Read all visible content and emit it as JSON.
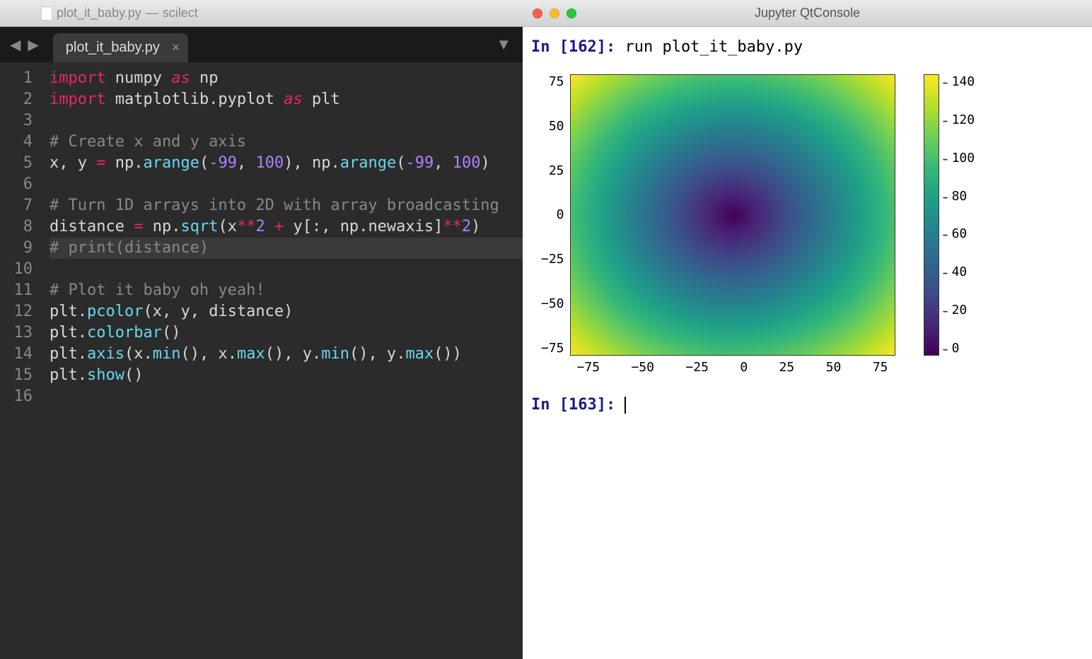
{
  "editor": {
    "window_title_file": "plot_it_baby.py",
    "window_title_project": "scilect",
    "tab_name": "plot_it_baby.py",
    "lines": [
      "1",
      "2",
      "3",
      "4",
      "5",
      "6",
      "7",
      "8",
      "9",
      "10",
      "11",
      "12",
      "13",
      "14",
      "15",
      "16"
    ],
    "code": {
      "l1_import": "import",
      "l1_mod": "numpy",
      "l1_as": "as",
      "l1_alias": "np",
      "l2_import": "import",
      "l2_mod": "matplotlib.pyplot",
      "l2_as": "as",
      "l2_alias": "plt",
      "l4": "# Create x and y axis",
      "l5_a": "x",
      "l5_comma1": ",",
      "l5_b": "y",
      "l5_eq": "=",
      "l5_np1": "np",
      "l5_dot1": ".",
      "l5_f1": "arange",
      "l5_p1": "(",
      "l5_n1": "-99",
      "l5_c1": ",",
      "l5_n2": "100",
      "l5_p2": "),",
      "l5_np2": "np",
      "l5_dot2": ".",
      "l5_f2": "arange",
      "l5_p3": "(",
      "l5_n3": "-99",
      "l5_c2": ",",
      "l5_n4": "100",
      "l5_p4": ")",
      "l7": "# Turn 1D arrays into 2D with array broadcasting",
      "l8_a": "distance",
      "l8_eq": "=",
      "l8_np": "np",
      "l8_d": ".",
      "l8_f": "sqrt",
      "l8_p1": "(x",
      "l8_pow1": "**",
      "l8_n1": "2",
      "l8_plus": "+",
      "l8_y": "y[:,",
      "l8_np2": "np",
      "l8_d2": ".",
      "l8_na": "newaxis]",
      "l8_pow2": "**",
      "l8_n2": "2",
      "l8_p2": ")",
      "l9": "# print(distance)",
      "l11": "# Plot it baby oh yeah!",
      "l12_a": "plt",
      "l12_d": ".",
      "l12_f": "pcolor",
      "l12_args": "(x, y, distance)",
      "l13_a": "plt",
      "l13_d": ".",
      "l13_f": "colorbar",
      "l13_args": "()",
      "l14_a": "plt",
      "l14_d": ".",
      "l14_f": "axis",
      "l14_p1": "(x",
      "l14_d1": ".",
      "l14_f1": "min",
      "l14_c1": "(), x",
      "l14_d2": ".",
      "l14_f2": "max",
      "l14_c2": "(), y",
      "l14_d3": ".",
      "l14_f3": "min",
      "l14_c3": "(), y",
      "l14_d4": ".",
      "l14_f4": "max",
      "l14_c4": "())",
      "l15_a": "plt",
      "l15_d": ".",
      "l15_f": "show",
      "l15_args": "()"
    }
  },
  "console": {
    "window_title": "Jupyter QtConsole",
    "prompt1": "In [162]:",
    "cmd1": "run plot_it_baby.py",
    "prompt2": "In [163]:"
  },
  "chart_data": {
    "type": "heatmap",
    "title": "",
    "xlabel": "",
    "ylabel": "",
    "x_range": [
      -99,
      99
    ],
    "y_range": [
      -99,
      99
    ],
    "x_ticks": [
      "−75",
      "−50",
      "−25",
      "0",
      "25",
      "50",
      "75"
    ],
    "y_ticks": [
      "75",
      "50",
      "25",
      "0",
      "−25",
      "−50",
      "−75"
    ],
    "colorbar_ticks": [
      "140",
      "120",
      "100",
      "80",
      "60",
      "40",
      "20",
      "0"
    ],
    "colorbar_range": [
      0,
      140
    ],
    "description": "Euclidean distance sqrt(x^2+y^2) over 199x199 grid; radial gradient from 0 at center to ~140 at corners",
    "colormap": "viridis"
  }
}
